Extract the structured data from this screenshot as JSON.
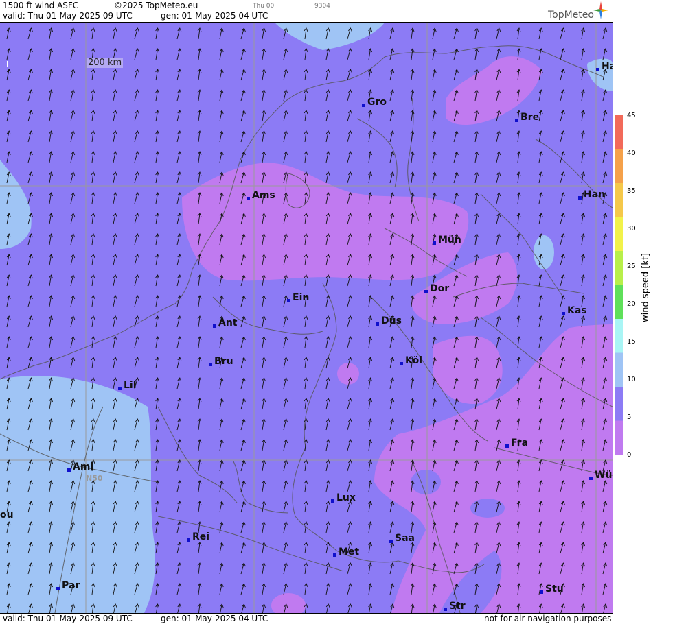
{
  "header": {
    "product": "1500 ft wind ASFC",
    "copyright": "©2025 TopMeteo.eu",
    "run_label": "Thu 00",
    "code": "9304",
    "valid_line": "valid:  Thu  01-May-2025  09 UTC",
    "gen_line": "gen: 01-May-2025 04 UTC",
    "brand": "TopMeteo"
  },
  "footer": {
    "valid_line": "valid:  Thu  01-May-2025  09 UTC",
    "gen_line": "gen: 01-May-2025 04 UTC",
    "disclaimer": "not for air navigation purposes"
  },
  "scale_bar": {
    "label": "200 km"
  },
  "grid_label": "N50",
  "legend": {
    "title": "wind  speed  [kt]",
    "ticks": [
      "45",
      "40",
      "35",
      "30",
      "25",
      "20",
      "15",
      "10",
      "5",
      "0"
    ],
    "colors": [
      "#f26a5a",
      "#f5a14a",
      "#f5c84a",
      "#f2f24a",
      "#b8ef4a",
      "#5fe05a",
      "#a9f5f5",
      "#9fc4f5",
      "#8c7bf5",
      "#c07af0"
    ]
  },
  "cities": [
    {
      "name": "Gro"
    },
    {
      "name": "Bre"
    },
    {
      "name": "Ha"
    },
    {
      "name": "Ams"
    },
    {
      "name": "Han"
    },
    {
      "name": "Mün"
    },
    {
      "name": "Ein"
    },
    {
      "name": "Dor"
    },
    {
      "name": "Kas"
    },
    {
      "name": "Ant"
    },
    {
      "name": "Düs"
    },
    {
      "name": "Bru"
    },
    {
      "name": "Köl"
    },
    {
      "name": "Lil"
    },
    {
      "name": "Fra"
    },
    {
      "name": "Ami"
    },
    {
      "name": "Wü"
    },
    {
      "name": "Lux"
    },
    {
      "name": "ou"
    },
    {
      "name": "Rei"
    },
    {
      "name": "Saa"
    },
    {
      "name": "Met"
    },
    {
      "name": "Par"
    },
    {
      "name": "Stu"
    },
    {
      "name": "Str"
    }
  ]
}
